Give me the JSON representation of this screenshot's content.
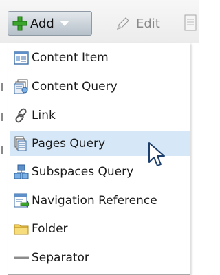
{
  "toolbar": {
    "add_label": "Add",
    "edit_label": "Edit"
  },
  "menu": {
    "items": [
      {
        "label": "Content Item",
        "icon": "content-item-icon"
      },
      {
        "label": "Content Query",
        "icon": "content-query-icon"
      },
      {
        "label": "Link",
        "icon": "link-icon"
      },
      {
        "label": "Pages Query",
        "icon": "pages-query-icon",
        "highlighted": true
      },
      {
        "label": "Subspaces Query",
        "icon": "subspaces-query-icon"
      },
      {
        "label": "Navigation Reference",
        "icon": "navigation-reference-icon"
      },
      {
        "label": "Folder",
        "icon": "folder-icon"
      },
      {
        "label": "Separator",
        "icon": "separator-icon"
      }
    ]
  },
  "colors": {
    "highlight": "#d6e8f7",
    "accent_green": "#3aa52a",
    "folder": "#f2cf5b"
  }
}
